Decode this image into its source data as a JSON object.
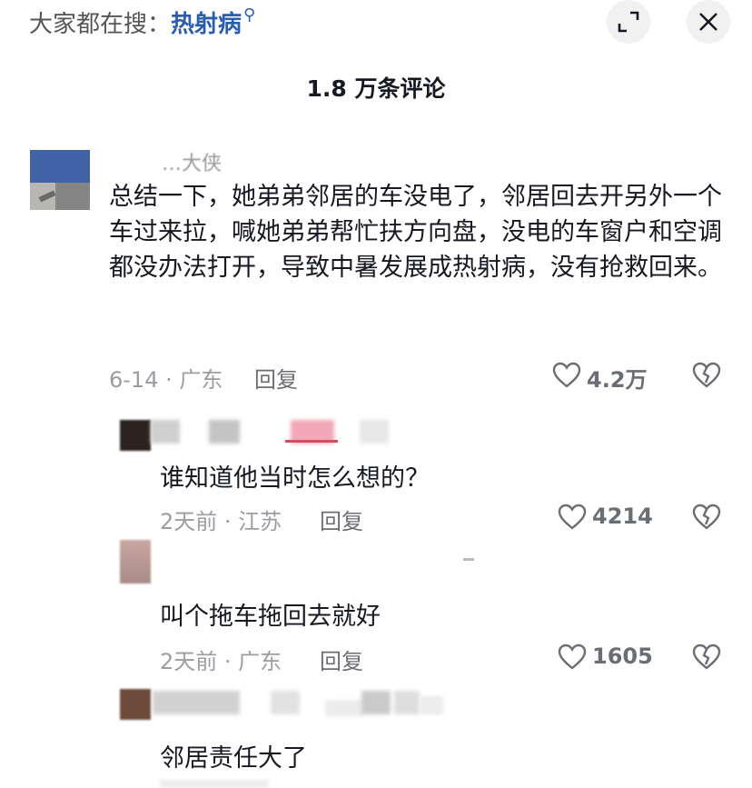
{
  "search": {
    "prefix": "大家都在搜：",
    "term": "热射病"
  },
  "header": {
    "title": "1.8 万条评论"
  },
  "icons": {
    "expand": "expand-icon",
    "close": "close-icon",
    "heart": "heart-icon",
    "dislike": "broken-heart-icon",
    "search": "search-icon"
  },
  "comments": [
    {
      "name_fragment": "…大侠",
      "text": "总结一下，她弟弟邻居的车没电了，邻居回去开另外一个车过来拉，喊她弟弟帮忙扶方向盘，没电的车窗户和空调都没办法打开，导致中暑发展成热射病，没有抢救回来。",
      "meta": "6-14 · 广东",
      "reply_label": "回复",
      "likes": "4.2万"
    },
    {
      "text": "谁知道他当时怎么想的？",
      "meta": "2天前 · 江苏",
      "reply_label": "回复",
      "likes": "4214"
    },
    {
      "text": "叫个拖车拖回去就好",
      "meta": "2天前 · 广东",
      "reply_label": "回复",
      "likes": "1605"
    },
    {
      "text": "邻居责任大了"
    }
  ],
  "colors": {
    "accent": "#2a5db0",
    "text": "#161823",
    "meta": "#9c9da3"
  }
}
